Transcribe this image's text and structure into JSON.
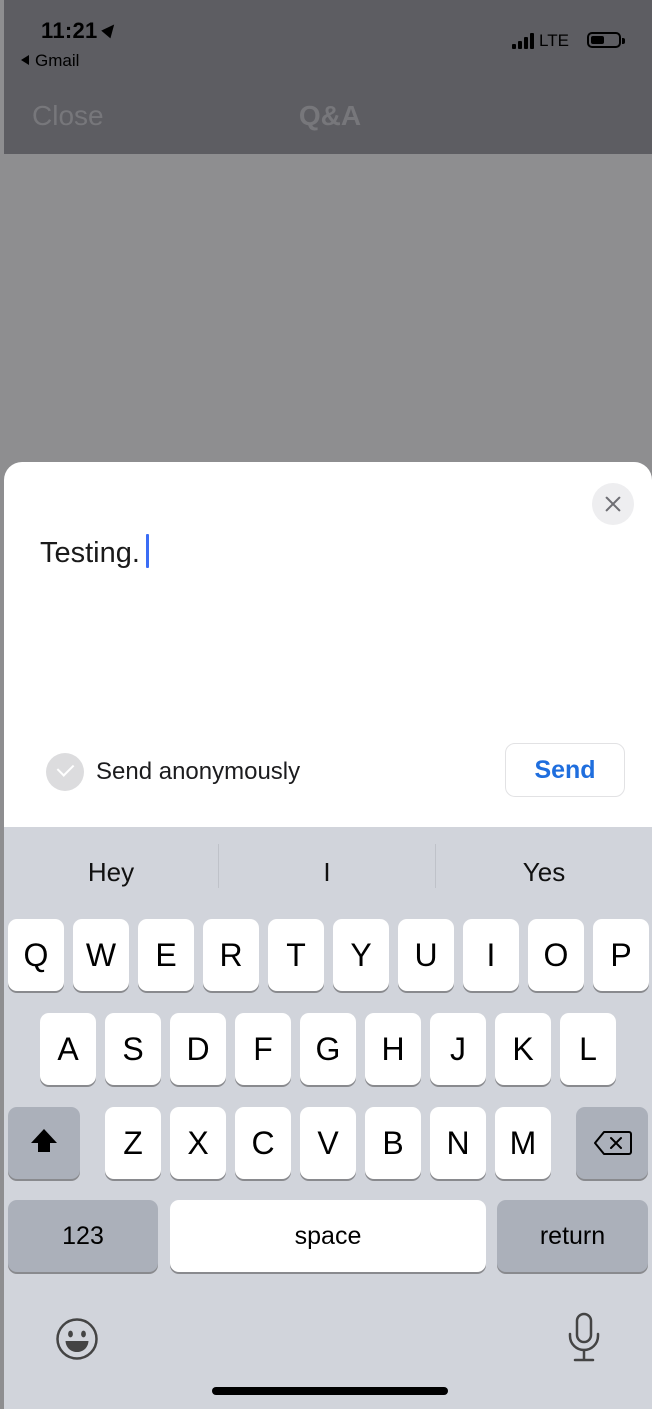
{
  "status_bar": {
    "time": "11:21",
    "back_app": "Gmail",
    "network": "LTE"
  },
  "navbar": {
    "close_label": "Close",
    "title": "Q&A"
  },
  "sheet": {
    "question_text": "Testing.",
    "anonymous_label": "Send anonymously",
    "anonymous_checked": false,
    "send_label": "Send"
  },
  "keyboard": {
    "suggestions": [
      "Hey",
      "I",
      "Yes"
    ],
    "row1": [
      "Q",
      "W",
      "E",
      "R",
      "T",
      "Y",
      "U",
      "I",
      "O",
      "P"
    ],
    "row2": [
      "A",
      "S",
      "D",
      "F",
      "G",
      "H",
      "J",
      "K",
      "L"
    ],
    "row3": [
      "Z",
      "X",
      "C",
      "V",
      "B",
      "N",
      "M"
    ],
    "numbers_label": "123",
    "space_label": "space",
    "return_label": "return",
    "icons": {
      "shift": "shift-icon",
      "backspace": "backspace-icon",
      "emoji": "emoji-icon",
      "mic": "microphone-icon"
    }
  },
  "colors": {
    "accent": "#1f6ede",
    "caret": "#3b6df5",
    "keyboard_bg": "#d1d4db"
  }
}
